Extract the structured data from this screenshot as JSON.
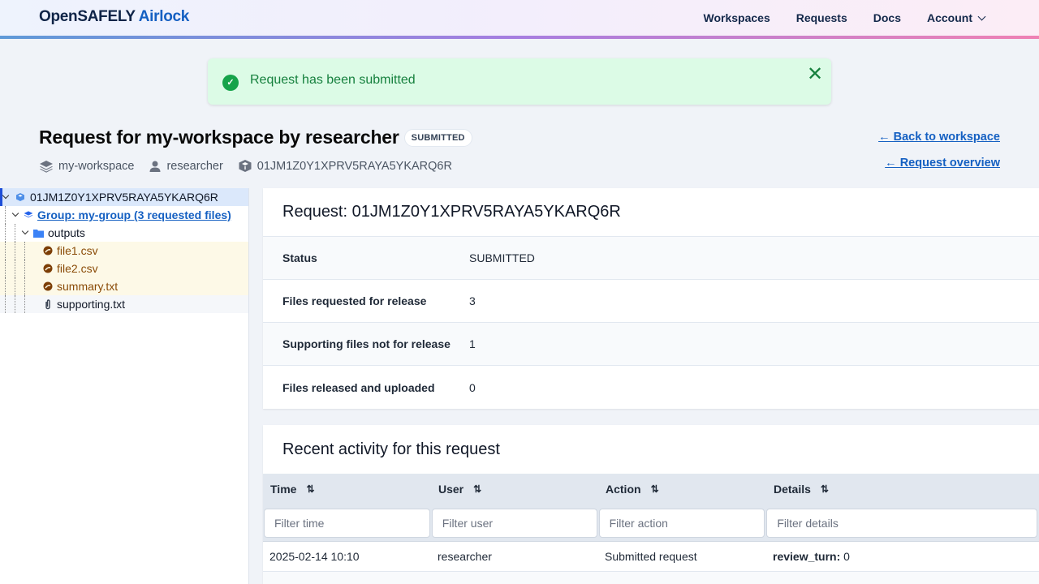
{
  "header": {
    "brand_primary": "OpenSAFELY",
    "brand_secondary": "Airlock",
    "nav": [
      {
        "label": "Workspaces"
      },
      {
        "label": "Requests"
      },
      {
        "label": "Docs"
      },
      {
        "label": "Account",
        "icon": "chevron-down-icon"
      }
    ]
  },
  "flash": {
    "icon": "check-circle-icon",
    "message": "Request has been submitted",
    "close_icon": "close-icon"
  },
  "page": {
    "title": "Request for my-workspace by researcher",
    "status_badge": "SUBMITTED",
    "meta": {
      "workspace": "my-workspace",
      "user": "researcher",
      "request_id": "01JM1Z0Y1XPRV5RAYA5YKARQ6R"
    },
    "back_to_workspace": "← Back to workspace",
    "request_overview": "← Request overview"
  },
  "tree": {
    "root": "01JM1Z0Y1XPRV5RAYA5YKARQ6R",
    "group": "Group: my-group (3 requested files)",
    "folder": "outputs",
    "files": [
      {
        "name": "file1.csv",
        "type": "requested"
      },
      {
        "name": "file2.csv",
        "type": "requested"
      },
      {
        "name": "summary.txt",
        "type": "requested"
      },
      {
        "name": "supporting.txt",
        "type": "supporting"
      }
    ]
  },
  "summary": {
    "title": "Request: 01JM1Z0Y1XPRV5RAYA5YKARQ6R",
    "rows": [
      {
        "label": "Status",
        "value": "SUBMITTED"
      },
      {
        "label": "Files requested for release",
        "value": "3"
      },
      {
        "label": "Supporting files not for release",
        "value": "1"
      },
      {
        "label": "Files released and uploaded",
        "value": "0"
      }
    ]
  },
  "activity": {
    "title": "Recent activity for this request",
    "columns": [
      "Time",
      "User",
      "Action",
      "Details"
    ],
    "filters": [
      "Filter time",
      "Filter user",
      "Filter action",
      "Filter details"
    ],
    "rows": [
      {
        "time": "2025-02-14 10:10",
        "user": "researcher",
        "action": "Submitted request",
        "detail_key": "review_turn:",
        "detail_value": "0"
      }
    ]
  },
  "colors": {
    "accent": "#1560c2",
    "success": "#15803d",
    "requested_bg": "#fdf9e7",
    "requested_text": "#8a4b07"
  }
}
